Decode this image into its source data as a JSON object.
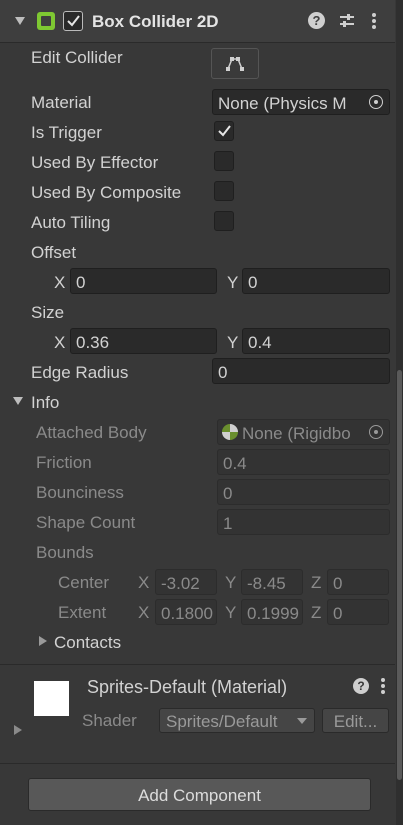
{
  "component": {
    "title": "Box Collider 2D",
    "enabled": true,
    "icon_color": "#7ec832",
    "edit_collider_label": "Edit Collider",
    "material_label": "Material",
    "material_value": "None (Physics M",
    "is_trigger_label": "Is Trigger",
    "is_trigger": true,
    "used_by_effector_label": "Used By Effector",
    "used_by_composite_label": "Used By Composite",
    "auto_tiling_label": "Auto Tiling",
    "offset_label": "Offset",
    "offset_x": "0",
    "offset_y": "0",
    "size_label": "Size",
    "size_x": "0.36",
    "size_y": "0.4",
    "edge_radius_label": "Edge Radius",
    "edge_radius_value": "0",
    "x_label": "X",
    "y_label": "Y",
    "z_label": "Z"
  },
  "info": {
    "label": "Info",
    "attached_body_label": "Attached Body",
    "attached_body_value": "None (Rigidbo",
    "friction_label": "Friction",
    "friction_value": "0.4",
    "bounciness_label": "Bounciness",
    "bounciness_value": "0",
    "shape_count_label": "Shape Count",
    "shape_count_value": "1",
    "bounds_label": "Bounds",
    "center_label": "Center",
    "center_x": "-3.02",
    "center_y": "-8.45",
    "center_z": "0",
    "extent_label": "Extent",
    "extent_x": "0.1800",
    "extent_y": "0.1999",
    "extent_z": "0",
    "contacts_label": "Contacts"
  },
  "material": {
    "title": "Sprites-Default (Material)",
    "shader_label": "Shader",
    "shader_value": "Sprites/Default",
    "edit_label": "Edit..."
  },
  "add_component_label": "Add Component"
}
